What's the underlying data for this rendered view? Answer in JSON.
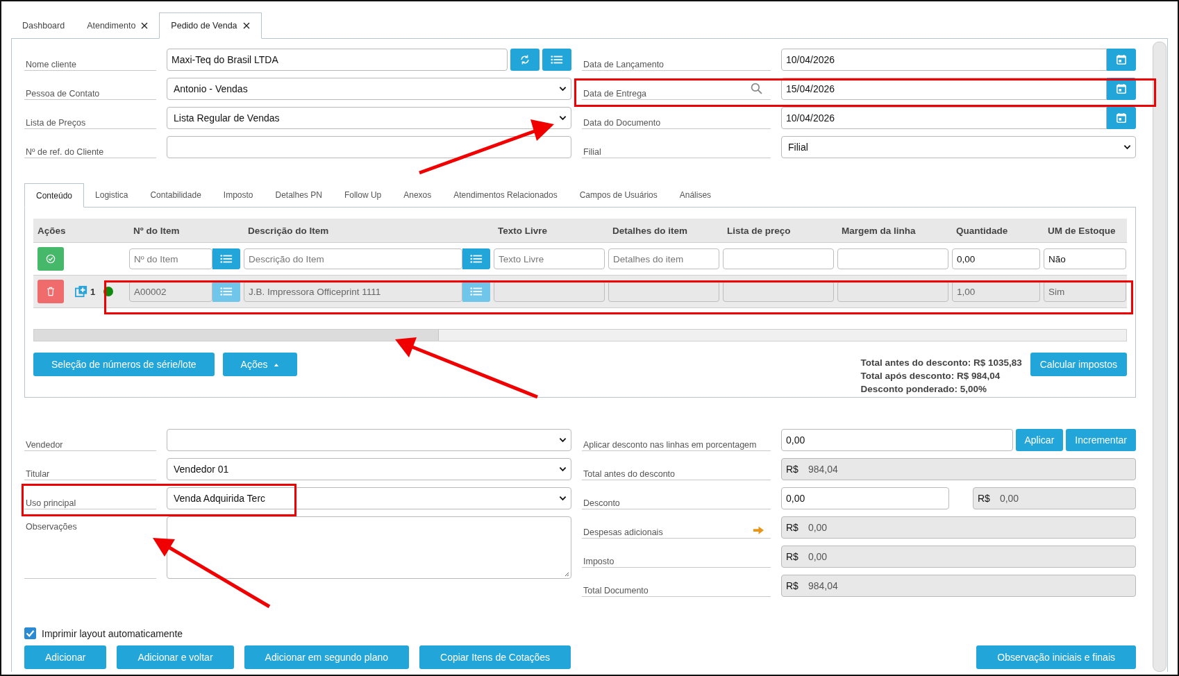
{
  "tabs": [
    {
      "label": "Dashboard",
      "selected": false,
      "closable": false
    },
    {
      "label": "Atendimento",
      "selected": false,
      "closable": true
    },
    {
      "label": "Pedido de Venda",
      "selected": true,
      "closable": true
    }
  ],
  "form_left": [
    {
      "label": "Nome cliente",
      "kind": "lookup",
      "value": "Maxi-Teq do Brasil LTDA"
    },
    {
      "label": "Pessoa de Contato",
      "kind": "select",
      "value": "Antonio - Vendas"
    },
    {
      "label": "Lista de Preços",
      "kind": "select",
      "value": "Lista Regular de Vendas"
    },
    {
      "label": "Nº de ref. do Cliente",
      "kind": "text"
    }
  ],
  "form_right": [
    {
      "label": "Data de Lançamento",
      "kind": "date",
      "value": "10/04/2026"
    },
    {
      "label": "Data de Entrega",
      "kind": "date",
      "value": "15/04/2026",
      "search_icon": true
    },
    {
      "label": "Data do Documento",
      "kind": "date",
      "value": "10/04/2026"
    },
    {
      "label": "Filial",
      "kind": "select",
      "value": "Filial"
    }
  ],
  "detail_tabs": [
    {
      "label": "Conteúdo",
      "selected": true
    },
    {
      "label": "Logistica",
      "selected": false
    },
    {
      "label": "Contabilidade",
      "selected": false
    },
    {
      "label": "Imposto",
      "selected": false
    },
    {
      "label": "Detalhes PN",
      "selected": false
    },
    {
      "label": "Follow Up",
      "selected": false
    },
    {
      "label": "Anexos",
      "selected": false
    },
    {
      "label": "Atendimentos Relacionados",
      "selected": false
    },
    {
      "label": "Campos de Usuários",
      "selected": false
    },
    {
      "label": "Análises",
      "selected": false
    }
  ],
  "table": {
    "columns": [
      "Ações",
      "Nº do Item",
      "Descrição do Item",
      "Texto Livre",
      "Detalhes do item",
      "Lista de preço",
      "Margem da linha",
      "Quantidade",
      "UM de Estoque"
    ],
    "new_row": {
      "disabled": false,
      "cells": [
        {
          "kind": "actions"
        },
        {
          "kind": "lookup",
          "placeholder": "Nº do Item"
        },
        {
          "kind": "lookup",
          "placeholder": "Descrição do Item"
        },
        {
          "kind": "text",
          "placeholder": "Texto Livre"
        },
        {
          "kind": "text",
          "placeholder": "Detalhes do item"
        },
        {
          "kind": "text"
        },
        {
          "kind": "text"
        },
        {
          "kind": "text",
          "value": "0,00"
        },
        {
          "kind": "text",
          "value": "Não"
        }
      ]
    },
    "rows": [
      {
        "disabled": true,
        "cells": [
          {
            "kind": "actions",
            "number": "1",
            "color": "#0f8a0f"
          },
          {
            "kind": "lookup",
            "value": "A00002"
          },
          {
            "kind": "lookup",
            "value": "J.B. Impressora Officeprint 1111"
          },
          {
            "kind": "text"
          },
          {
            "kind": "text"
          },
          {
            "kind": "text"
          },
          {
            "kind": "text"
          },
          {
            "kind": "text",
            "value": "1,00"
          },
          {
            "kind": "text",
            "value": "Sim"
          }
        ]
      }
    ]
  },
  "table_buttons": [
    {
      "label": "Seleção de números de série/lote",
      "kind": "plain"
    },
    {
      "label": "Ações",
      "kind": "dropdown"
    }
  ],
  "totals": [
    "Total antes do desconto: R$ 1035,83",
    "Total após desconto: R$ 984,04",
    "Desconto ponderado: 5,00%"
  ],
  "calc_button": "Calcular impostos",
  "form_bottom_left": [
    {
      "label": "Vendedor",
      "kind": "select"
    },
    {
      "label": "Titular",
      "kind": "select",
      "value": "Vendedor 01"
    },
    {
      "label": "Uso principal",
      "kind": "select",
      "value": "Venda Adquirida Terc"
    },
    {
      "label": "Observações",
      "kind": "textarea"
    }
  ],
  "form_bottom_right": [
    {
      "label": "Aplicar desconto nas linhas em porcentagem",
      "kind": "input_buttons",
      "value": "0,00",
      "buttons": [
        "Aplicar",
        "Incrementar"
      ]
    },
    {
      "label": "Total antes do desconto",
      "kind": "currency",
      "prefix": "R$",
      "value": "984,04"
    },
    {
      "label": "Desconto",
      "kind": "split",
      "value": "0,00",
      "prefix": "R$",
      "amount": "0,00"
    },
    {
      "label": "Despesas adicionais",
      "kind": "currency",
      "prefix": "R$",
      "value": "0,00",
      "arrow_icon": true
    },
    {
      "label": "Imposto",
      "kind": "currency",
      "prefix": "R$",
      "value": "0,00"
    },
    {
      "label": "Total Documento",
      "kind": "currency",
      "prefix": "R$",
      "value": "984,04"
    }
  ],
  "print_checkbox": {
    "label": "Imprimir layout automaticamente",
    "checked": true
  },
  "footer_buttons": [
    "Adicionar",
    "Adicionar e voltar",
    "Adicionar em segundo plano",
    "Copiar Itens de Cotações"
  ],
  "footer_right_button": "Observação iniciais e finais"
}
